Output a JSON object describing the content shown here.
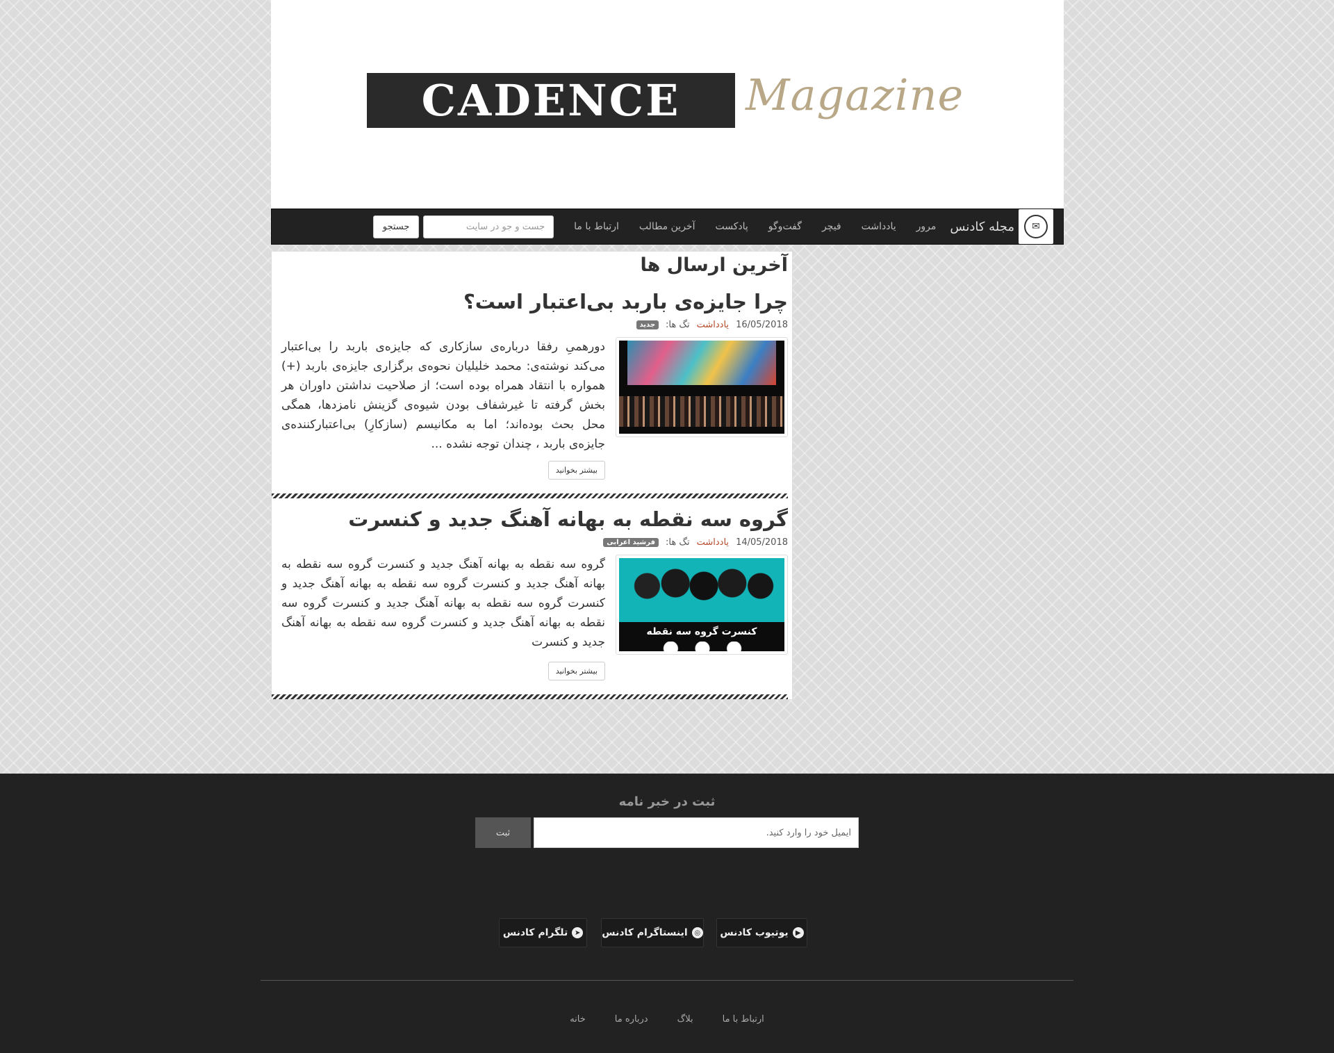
{
  "header": {
    "logo_word": "CADENCE",
    "logo_sub": "Magazine"
  },
  "navbar": {
    "brand": "مجله کادنس",
    "brand_icon": "cadence-emblem-icon",
    "items": [
      "مرور",
      "یادداشت",
      "فیچر",
      "گفت‌وگو",
      "پادکست",
      "آخرین مطالب",
      "ارتباط با ما"
    ],
    "search_placeholder": "جست و جو در سایت",
    "search_button": "جستجو"
  },
  "main": {
    "section_title": "آخرین ارسال ها",
    "posts": [
      {
        "title": "چرا جایزه‌ی باربد بی‌اعتبار است؟",
        "date": "16/05/2018",
        "category": "یادداشت",
        "tags_label": "تگ ها:",
        "tag": "جدید",
        "excerpt": "دورهمیِ رفقا درباره‌ی سازکاری که جایزه‌ی باربد را بی‌اعتبار می‌کند نوشته‌ی: محمد خلیلیان نحوه‌ی برگزاری جایزه‌ی باربد (+) همواره با انتقاد همراه بوده است؛ از صلاحیت نداشتن داوران هر بخش گرفته تا غیرشفاف بودن شیوه‌ی گزینش نامزدها، همگی محل بحث بوده‌اند؛ اما به مکانیسم (سازکارِ) بی‌اعتبارکننده‌ی جایزه‌ی باربد ، چندان توجه نشده ...",
        "more": "بیشتر بخوانید"
      },
      {
        "title": "گروه سه نقطه به بهانه آهنگ جدید و کنسرت",
        "date": "14/05/2018",
        "category": "یادداشت",
        "tags_label": "تگ ها:",
        "tag": "فرشید اعرابی",
        "thumb_caption": "کنسرت گروه سه نقطه",
        "excerpt": "گروه سه نقطه به بهانه آهنگ جدید و کنسرت گروه سه نقطه به بهانه آهنگ جدید و کنسرت گروه سه نقطه به بهانه آهنگ جدید و کنسرت گروه سه نقطه به بهانه آهنگ جدید و کنسرت گروه سه نقطه به بهانه آهنگ جدید و کنسرت گروه سه نقطه به بهانه آهنگ جدید و کنسرت",
        "more": "بیشتر بخوانید"
      }
    ]
  },
  "footer": {
    "newsletter_title": "ثبت در خبر نامه",
    "newsletter_placeholder": "ایمیل خود را وارد کنید.",
    "newsletter_button": "ثبت",
    "social": {
      "youtube": "یوتیوب کادنس",
      "instagram": "اینستاگرام کادنس",
      "telegram": "تلگرام کادنس"
    },
    "links": [
      "ارتباط با ما",
      "بلاگ",
      "درباره ما",
      "خانه"
    ]
  }
}
